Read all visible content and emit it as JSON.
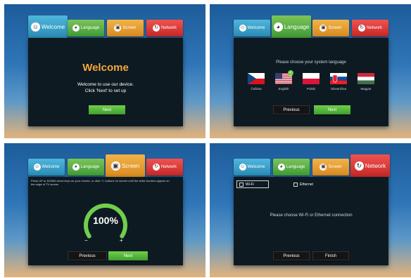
{
  "tabs": [
    {
      "label": "Welcome",
      "icon": "face-icon",
      "glyph": "☺"
    },
    {
      "label": "Language",
      "icon": "globe-icon",
      "glyph": "◕"
    },
    {
      "label": "Screen",
      "icon": "screen-icon",
      "glyph": "▣"
    },
    {
      "label": "Network",
      "icon": "network-icon",
      "glyph": "↻"
    }
  ],
  "welcome": {
    "title": "Welcome",
    "line1": "Welcome to use our device.",
    "line2": "Click 'Next' to set up",
    "next_label": "Next"
  },
  "language": {
    "prompt": "Please choose your system language",
    "options": [
      "Čeština",
      "English",
      "Polski",
      "Slovenčina",
      "Magyar"
    ],
    "selected": "English",
    "previous_label": "Previous",
    "next_label": "Next"
  },
  "screen": {
    "help": "Press UP or DOWN arrow keys on your remote, or click +/- buttons on screen until the white borders appear on the edge of TV screen",
    "zoom_value": "100%",
    "zoom_fraction": 1.0,
    "minus": "−",
    "plus": "+",
    "previous_label": "Previous",
    "next_label": "Next"
  },
  "network": {
    "wifi_label": "Wi-Fi",
    "ethernet_label": "Ethernet",
    "message": "Please choose Wi-Fi or Ethernet connection",
    "previous_label": "Previous",
    "finish_label": "Finish"
  }
}
